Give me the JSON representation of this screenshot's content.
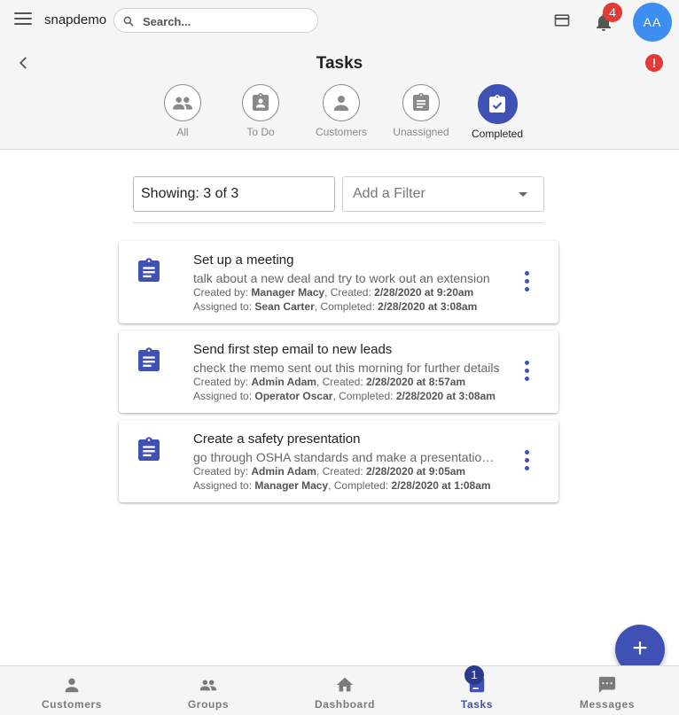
{
  "app": {
    "name": "snapdemo"
  },
  "search": {
    "placeholder": "Search..."
  },
  "header": {
    "notification_count": "4",
    "avatar_initials": "AA",
    "alert_symbol": "!"
  },
  "page": {
    "title": "Tasks"
  },
  "tabs": [
    {
      "label": "All",
      "icon": "people-icon"
    },
    {
      "label": "To Do",
      "icon": "clipboard-account-icon"
    },
    {
      "label": "Customers",
      "icon": "person-icon"
    },
    {
      "label": "Unassigned",
      "icon": "clipboard-icon"
    },
    {
      "label": "Completed",
      "icon": "clipboard-check-icon",
      "active": true
    }
  ],
  "filters": {
    "showing": "Showing: 3 of 3",
    "add_filter_placeholder": "Add a Filter"
  },
  "tasks": [
    {
      "title": "Set up a meeting",
      "description": "talk about a new deal and try to work out an extension",
      "created_by_label": "Created by:",
      "created_by": "Manager Macy",
      "created_label": "Created:",
      "created": "2/28/2020 at 9:20am",
      "assigned_to_label": "Assigned to:",
      "assigned_to": "Sean Carter",
      "completed_label": "Completed:",
      "completed": "2/28/2020 at 3:08am"
    },
    {
      "title": "Send first step email to new leads",
      "description": "check the memo sent out this morning for further details",
      "created_by_label": "Created by:",
      "created_by": "Admin Adam",
      "created_label": "Created:",
      "created": "2/28/2020 at 8:57am",
      "assigned_to_label": "Assigned to:",
      "assigned_to": "Operator Oscar",
      "completed_label": "Completed:",
      "completed": "2/28/2020 at 3:08am"
    },
    {
      "title": "Create a safety presentation",
      "description": "go through OSHA standards and make a presentation for the team",
      "created_by_label": "Created by:",
      "created_by": "Admin Adam",
      "created_label": "Created:",
      "created": "2/28/2020 at 9:05am",
      "assigned_to_label": "Assigned to:",
      "assigned_to": "Manager Macy",
      "completed_label": "Completed:",
      "completed": "2/28/2020 at 1:08am"
    }
  ],
  "fab": {
    "symbol": "+"
  },
  "bottom_nav": [
    {
      "label": "Customers",
      "icon": "person-icon"
    },
    {
      "label": "Groups",
      "icon": "groups-icon"
    },
    {
      "label": "Dashboard",
      "icon": "home-icon"
    },
    {
      "label": "Tasks",
      "icon": "clipboard-icon",
      "badge": "1",
      "active": true
    },
    {
      "label": "Messages",
      "icon": "message-icon"
    }
  ],
  "colors": {
    "primary": "#3f51b5",
    "badge_red": "#e53935",
    "avatar_blue": "#3d8ef0",
    "bar_bg": "#f5f5f5"
  }
}
